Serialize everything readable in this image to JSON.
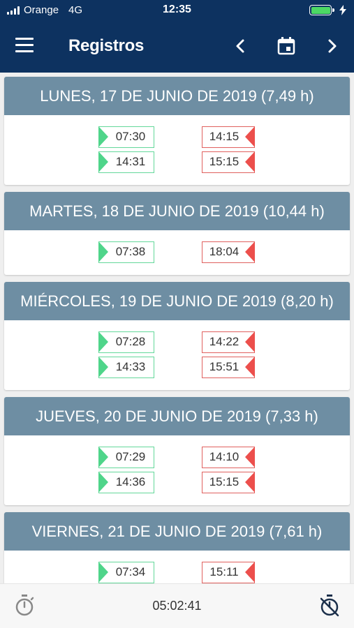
{
  "status_bar": {
    "carrier": "Orange",
    "network": "4G",
    "time": "12:35"
  },
  "app_bar": {
    "title": "Registros",
    "menu_icon": "menu-icon",
    "prev_icon": "chevron-left-icon",
    "calendar_icon": "calendar-icon",
    "next_icon": "chevron-right-icon"
  },
  "colors": {
    "primary": "#0d3260",
    "day_header": "#6e8ea3",
    "entry": "#4fd58a",
    "exit": "#ec4f4c",
    "battery": "#4cd964"
  },
  "days": [
    {
      "header": "LUNES, 17 DE JUNIO DE 2019 (7,49 h)",
      "entries": [
        {
          "in": "07:30",
          "out": "14:15"
        },
        {
          "in": "14:31",
          "out": "15:15"
        }
      ]
    },
    {
      "header": "MARTES, 18 DE JUNIO DE 2019 (10,44 h)",
      "entries": [
        {
          "in": "07:38",
          "out": "18:04"
        }
      ]
    },
    {
      "header": "MIÉRCOLES, 19 DE JUNIO DE 2019 (8,20 h)",
      "entries": [
        {
          "in": "07:28",
          "out": "14:22"
        },
        {
          "in": "14:33",
          "out": "15:51"
        }
      ]
    },
    {
      "header": "JUEVES, 20 DE JUNIO DE 2019 (7,33 h)",
      "entries": [
        {
          "in": "07:29",
          "out": "14:10"
        },
        {
          "in": "14:36",
          "out": "15:15"
        }
      ]
    },
    {
      "header": "VIERNES, 21 DE JUNIO DE 2019 (7,61 h)",
      "entries": [
        {
          "in": "07:34",
          "out": "15:11"
        }
      ]
    }
  ],
  "bottom_bar": {
    "timer": "05:02:41",
    "left_icon": "stopwatch-icon",
    "right_icon": "stopwatch-off-icon"
  }
}
